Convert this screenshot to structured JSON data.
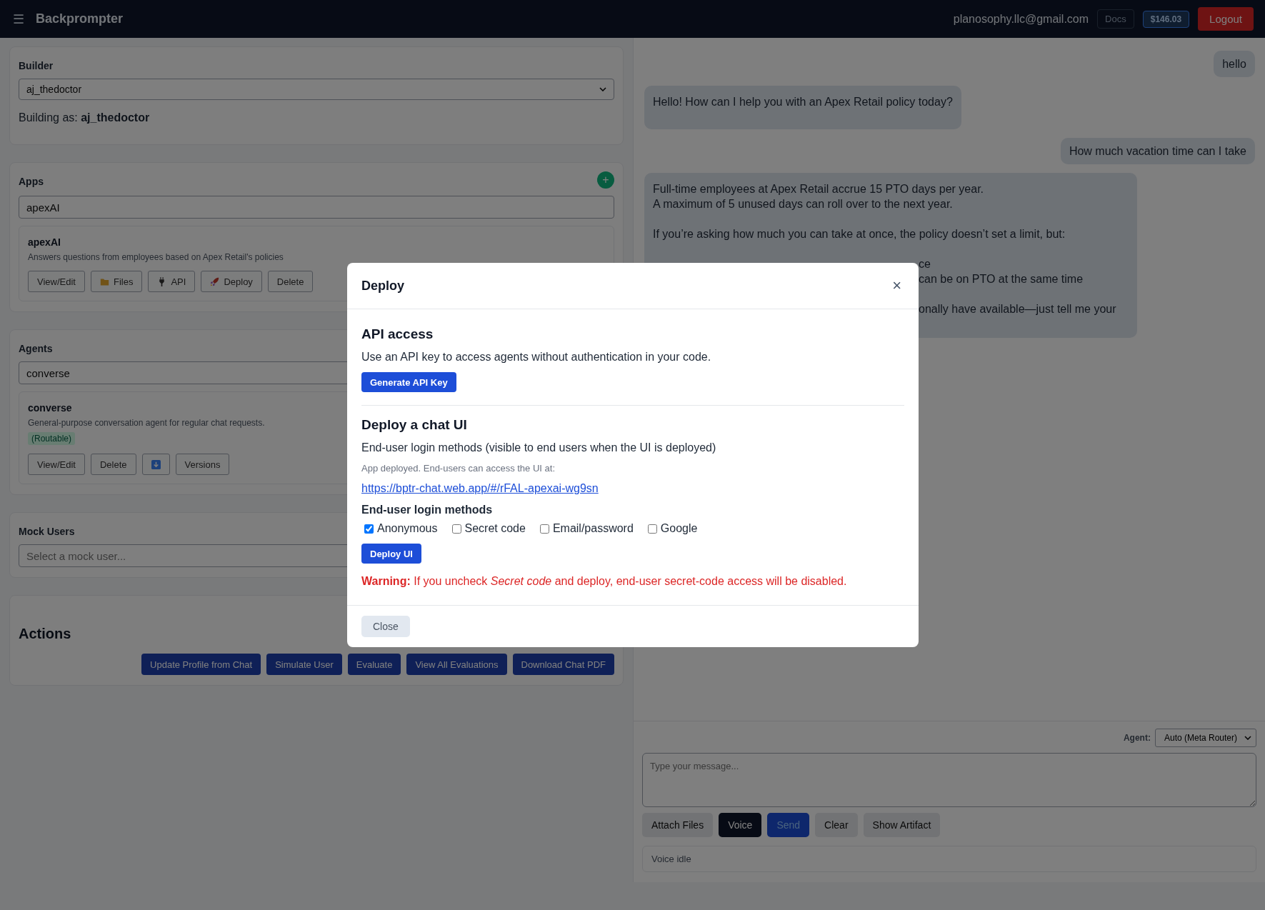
{
  "topbar": {
    "menu_icon": "☰",
    "title": "Backprompter",
    "email": "planosophy.llc@gmail.com",
    "docs": "Docs",
    "balance": "$146.03",
    "logout": "Logout"
  },
  "builder": {
    "title": "Builder",
    "select": "aj_thedoctor",
    "building_as": "Building as: **aj_thedoctor**"
  },
  "apps": {
    "title": "Apps",
    "add": "+",
    "select": "apexAI",
    "app": {
      "name": "apexAI",
      "description": "Answers questions from employees based on Apex Retail's policies",
      "buttons": [
        {
          "label": "View/Edit"
        },
        {
          "label": "Files"
        },
        {
          "label": "API"
        },
        {
          "label": "Deploy"
        },
        {
          "label": "Delete"
        }
      ]
    }
  },
  "agents": {
    "title": "Agents",
    "select": "converse",
    "agent": {
      "name": "converse",
      "description": "General-purpose conversation agent for regular chat requests.",
      "badge": "(Routable)",
      "buttons": [
        {
          "label": "View/Edit"
        },
        {
          "label": "Delete"
        },
        {
          "kind": "icon"
        },
        {
          "label": "Versions"
        }
      ]
    }
  },
  "mock_users": {
    "title": "Mock Users",
    "placeholder": "Select a mock user..."
  },
  "actions": {
    "title": "Actions",
    "buttons": [
      "Update Profile from Chat",
      "Simulate User",
      "Evaluate",
      "View All Evaluations",
      "Download Chat PDF"
    ]
  },
  "chat": {
    "messages": [
      {
        "kind": "user",
        "lines": [
          {
            "kind": "text",
            "text": "hello"
          }
        ]
      },
      {
        "kind": "assistant",
        "lines": [
          {
            "kind": "text",
            "text": "Hello! How can I help you with an Apex Retail policy today?"
          }
        ]
      },
      {
        "kind": "user",
        "lines": [
          {
            "kind": "text",
            "text": "How much vacation time can I take"
          }
        ]
      },
      {
        "kind": "assistant",
        "lines": [
          {
            "kind": "text",
            "text": "Full-time employees at Apex Retail accrue 15 PTO days per year."
          },
          {
            "kind": "text",
            "text": "A maximum of 5 unused days can roll over to the next year."
          },
          {
            "kind": "gap"
          },
          {
            "kind": "text",
            "text": "If you’re asking how much you can take at once, the policy doesn’t set a limit, but:"
          },
          {
            "kind": "gap"
          },
          {
            "kind": "fragment",
            "text": "ce"
          },
          {
            "kind": "fragment",
            "text": "can be on PTO at the same time"
          },
          {
            "kind": "gap"
          },
          {
            "kind": "fragment",
            "text": "onally have available—just tell me your"
          }
        ]
      }
    ],
    "agent_label": "Agent:",
    "agent_select": "Auto (Meta Router)",
    "input_placeholder": "Type your message...",
    "buttons": [
      {
        "label": "Attach Files",
        "kind": "secondary"
      },
      {
        "label": "Voice",
        "kind": "dark"
      },
      {
        "label": "Send",
        "kind": "primary"
      },
      {
        "label": "Clear",
        "kind": "secondary"
      },
      {
        "label": "Show Artifact",
        "kind": "secondary"
      }
    ],
    "status": "Voice idle"
  },
  "modal": {
    "title": "Deploy",
    "close_icon": "×",
    "api_title": "API access",
    "api_text": "Use an API key to access agents without authentication in your code.",
    "generate_button": "Generate API Key",
    "deploy_title": "Deploy a chat UI",
    "deploy_text": "End-user login methods (visible to end users when the UI is deployed)",
    "deployed_note": "App deployed. End-users can access the UI at:",
    "url": "https://bptr-chat.web.app/#/rFAL-apexai-wg9sn",
    "methods_title": "End-user login methods",
    "methods": [
      {
        "label": "Anonymous",
        "checked": true
      },
      {
        "label": "Secret code",
        "checked": false
      },
      {
        "label": "Email/password",
        "checked": false
      },
      {
        "label": "Google",
        "checked": false
      }
    ],
    "deploy_button": "Deploy UI",
    "warning": "**Warning:** If you uncheck *Secret code* and deploy, end-user secret-code access will be disabled.",
    "close_button": "Close"
  }
}
